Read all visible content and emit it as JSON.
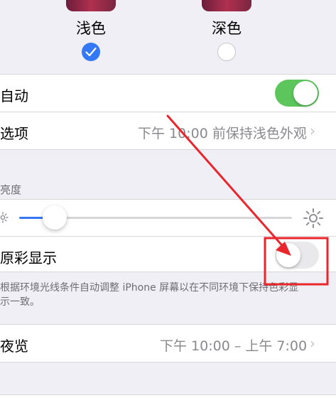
{
  "appearance": {
    "light_label": "浅色",
    "dark_label": "深色",
    "selected": "light"
  },
  "automatic": {
    "label": "自动",
    "toggle_on": true
  },
  "options": {
    "label": "选项",
    "value": "下午 10:00 前保持浅色外观"
  },
  "brightness": {
    "header": "亮度",
    "level": 0.13
  },
  "true_tone": {
    "label": "原彩显示",
    "toggle_on": false,
    "footer": "根据环境光线条件自动调整 iPhone 屏幕以在不同环境下保持色彩显示一致。"
  },
  "night_shift": {
    "label": "夜览",
    "value": "下午 10:00 – 上午 7:00"
  },
  "colors": {
    "accent": "#3478f6",
    "toggle_on": "#5cc65d",
    "annotation": "#e8262c"
  },
  "icons": [
    "checkmark-icon",
    "sun-small-icon",
    "sun-large-icon",
    "chevron-right-icon"
  ]
}
